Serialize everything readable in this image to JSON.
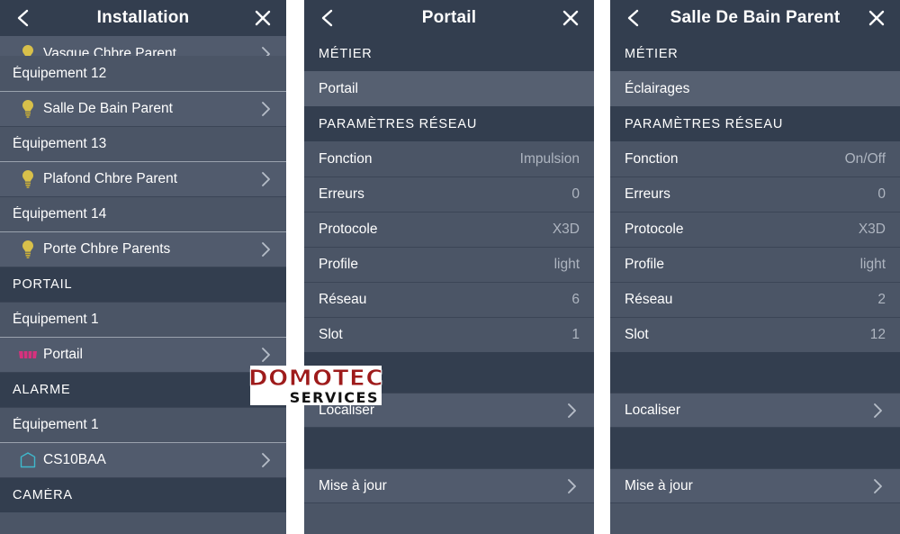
{
  "colors": {
    "panel_bg": "#4b5566",
    "header_bg": "#333e4f",
    "row_item_bg": "#515b6d",
    "metier_bg": "#566071",
    "text": "#ffffff",
    "value_text": "#aeb5c0",
    "bulb_icon": "#d8c04a",
    "gate_icon": "#d6327e",
    "sensor_icon": "#3fb8cc",
    "logo_red": "#9e1b1b"
  },
  "left_panel": {
    "header": {
      "title": "Installation",
      "back_icon": "chevron-left-icon",
      "close_icon": "close-icon"
    },
    "rows": [
      {
        "kind": "item-clipped",
        "label": "Vasque Chbre Parent",
        "icon": "lightbulb-icon",
        "chevron": "chevron-right-icon"
      },
      {
        "kind": "sub",
        "label": "Équipement 12"
      },
      {
        "kind": "item",
        "label": "Salle De Bain Parent",
        "icon": "lightbulb-icon",
        "chevron": "chevron-right-icon"
      },
      {
        "kind": "sub",
        "label": "Équipement 13"
      },
      {
        "kind": "item",
        "label": "Plafond Chbre Parent",
        "icon": "lightbulb-icon",
        "chevron": "chevron-right-icon"
      },
      {
        "kind": "sub",
        "label": "Équipement 14"
      },
      {
        "kind": "item",
        "label": "Porte Chbre Parents",
        "icon": "lightbulb-icon",
        "chevron": "chevron-right-icon"
      },
      {
        "kind": "section",
        "label": "PORTAIL"
      },
      {
        "kind": "sub",
        "label": "Équipement 1"
      },
      {
        "kind": "item",
        "label": "Portail",
        "icon": "gate-icon",
        "chevron": "chevron-right-icon"
      },
      {
        "kind": "section",
        "label": "ALARME"
      },
      {
        "kind": "sub",
        "label": "Équipement 1"
      },
      {
        "kind": "item",
        "label": "CS10BAA",
        "icon": "sensor-icon",
        "chevron": "chevron-right-icon"
      },
      {
        "kind": "section",
        "label": "CAMÉRA"
      }
    ]
  },
  "mid_panel": {
    "header": {
      "title": "Portail",
      "back_icon": "chevron-left-icon",
      "close_icon": "close-icon"
    },
    "metier_section": "MÉTIER",
    "metier_value": "Portail",
    "network_section": "PARAMÈTRES RÉSEAU",
    "params": [
      {
        "key": "Fonction",
        "value": "Impulsion"
      },
      {
        "key": "Erreurs",
        "value": "0"
      },
      {
        "key": "Protocole",
        "value": "X3D"
      },
      {
        "key": "Profile",
        "value": "light"
      },
      {
        "key": "Réseau",
        "value": "6"
      },
      {
        "key": "Slot",
        "value": "1"
      }
    ],
    "actions": [
      {
        "label": "Localiser",
        "chevron": "chevron-right-icon"
      },
      {
        "label": "Mise à jour",
        "chevron": "chevron-right-icon"
      }
    ]
  },
  "right_panel": {
    "header": {
      "title": "Salle De Bain Parent",
      "back_icon": "chevron-left-icon",
      "close_icon": "close-icon"
    },
    "metier_section": "MÉTIER",
    "metier_value": "Éclairages",
    "network_section": "PARAMÈTRES RÉSEAU",
    "params": [
      {
        "key": "Fonction",
        "value": "On/Off"
      },
      {
        "key": "Erreurs",
        "value": "0"
      },
      {
        "key": "Protocole",
        "value": "X3D"
      },
      {
        "key": "Profile",
        "value": "light"
      },
      {
        "key": "Réseau",
        "value": "2"
      },
      {
        "key": "Slot",
        "value": "12"
      }
    ],
    "actions": [
      {
        "label": "Localiser",
        "chevron": "chevron-right-icon"
      },
      {
        "label": "Mise à jour",
        "chevron": "chevron-right-icon"
      }
    ]
  },
  "watermark": {
    "line1": "DOMOTEC",
    "line2": "SERVICES"
  }
}
